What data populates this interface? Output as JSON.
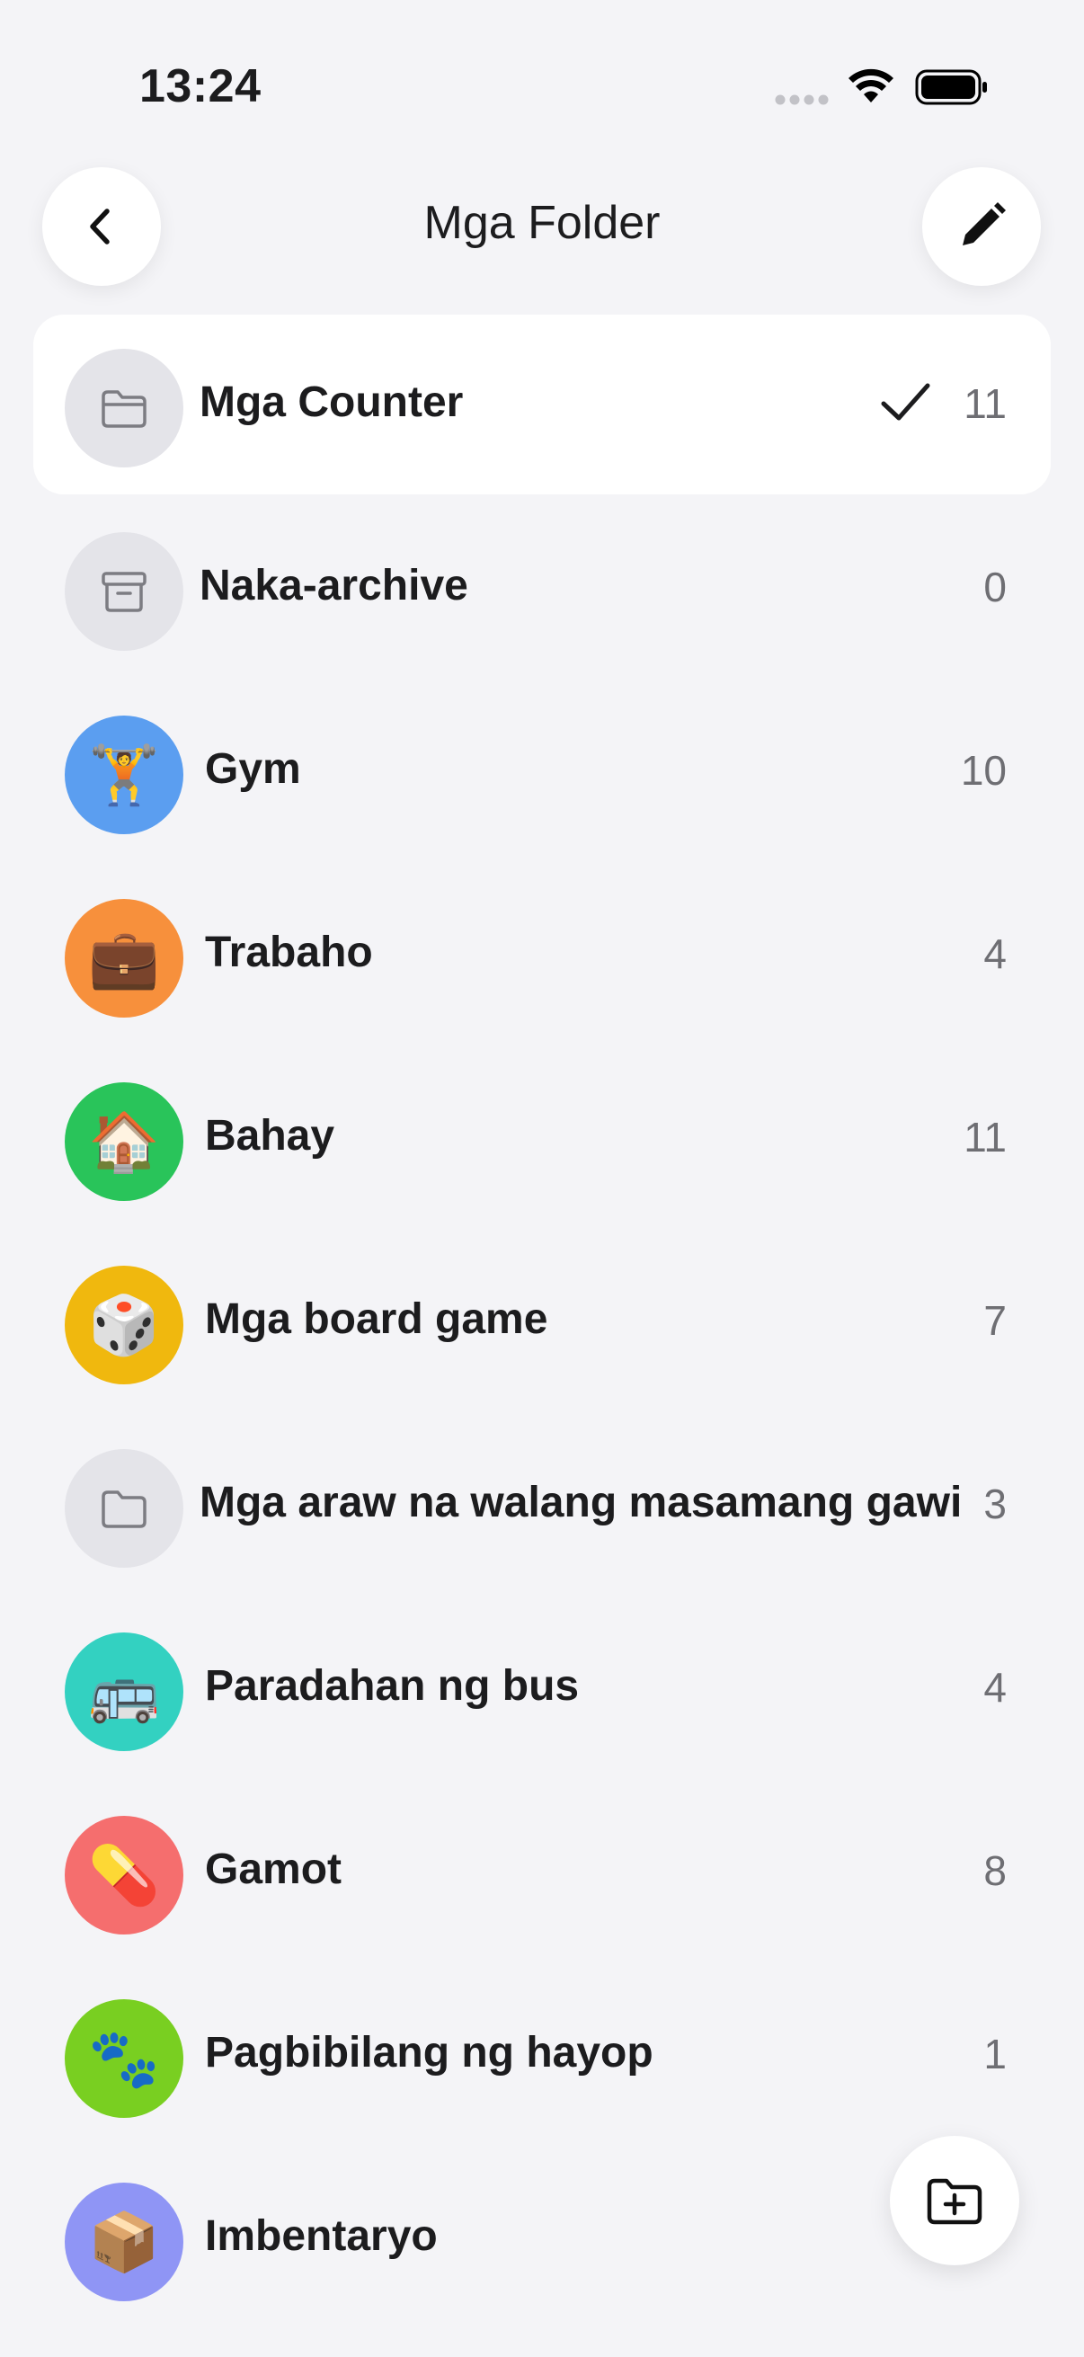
{
  "status_bar": {
    "time": "13:24",
    "icons": [
      "signal-dots-icon",
      "wifi-icon",
      "battery-icon"
    ]
  },
  "nav": {
    "title": "Mga Folder",
    "back_icon": "chevron-left-icon",
    "edit_icon": "pencil-icon"
  },
  "colors": {
    "background": "#f4f4f7",
    "gym": "#5b9ef0",
    "trabaho": "#f7903c",
    "bahay": "#29c45a",
    "board_game": "#f0b80e",
    "bus": "#33d1c1",
    "gamot": "#f56e6e",
    "hayop": "#79cf21",
    "imbentaryo": "#8f95f5",
    "neutral_avatar": "#e4e4e9"
  },
  "folders": [
    {
      "label": "Mga Counter",
      "count": "11",
      "icon": "folder-icon",
      "selected": true
    },
    {
      "label": "Naka-archive",
      "count": "0",
      "icon": "archive-box-icon"
    },
    {
      "label": "Gym",
      "count": "10",
      "icon": "weightlifter-emoji",
      "emoji": "🏋️"
    },
    {
      "label": "Trabaho",
      "count": "4",
      "icon": "briefcase-emoji",
      "emoji": "💼"
    },
    {
      "label": "Bahay",
      "count": "11",
      "icon": "house-emoji",
      "emoji": "🏠"
    },
    {
      "label": "Mga board game",
      "count": "7",
      "icon": "dice-emoji",
      "emoji": "🎲"
    },
    {
      "label": "Mga araw na walang masamang gawi",
      "count": "3",
      "icon": "folder-icon"
    },
    {
      "label": "Paradahan ng bus",
      "count": "4",
      "icon": "bus-emoji",
      "emoji": "🚌"
    },
    {
      "label": "Gamot",
      "count": "8",
      "icon": "pill-emoji",
      "emoji": "💊"
    },
    {
      "label": "Pagbibilang ng hayop",
      "count": "1",
      "icon": "paw-prints-emoji",
      "emoji": "🐾"
    },
    {
      "label": "Imbentaryo",
      "count": "",
      "icon": "package-emoji",
      "emoji": "📦"
    }
  ],
  "fab": {
    "icon": "folder-plus-icon"
  }
}
